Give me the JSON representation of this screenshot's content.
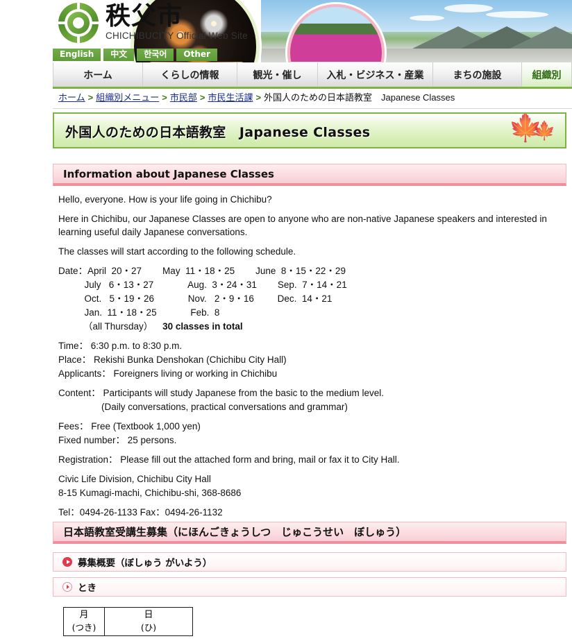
{
  "site": {
    "logo_jp": "秩父市",
    "logo_en": "CHICHIBUCITY Official Web Site",
    "logo_icon": "chichibu-city-emblem"
  },
  "lang_bar": {
    "items": [
      {
        "label": "English"
      },
      {
        "label": "中文"
      },
      {
        "label": "한국어"
      },
      {
        "label": "Other"
      }
    ]
  },
  "global_nav": {
    "items": [
      {
        "label": "ホーム",
        "active": false
      },
      {
        "label": "くらしの情報",
        "active": false
      },
      {
        "label": "観光・催し",
        "active": false
      },
      {
        "label": "入札・ビジネス・産業",
        "active": false
      },
      {
        "label": "まちの施設",
        "active": false
      },
      {
        "label": "組織別",
        "active": true
      }
    ]
  },
  "breadcrumb": {
    "links": [
      {
        "label": "ホーム"
      },
      {
        "label": "組織別メニュー"
      },
      {
        "label": "市民部"
      },
      {
        "label": "市民生活課"
      }
    ],
    "separator": ">",
    "current": "外国人のための日本語教室　Japanese Classes"
  },
  "page_title": "外国人のための日本語教室　Japanese Classes",
  "section_info": {
    "heading": "Information about Japanese Classes",
    "greeting": "Hello, everyone. How is your life going in Chichibu?",
    "intro": "Here in Chichibu, our Japanese Classes are open to anyone who are non-native Japanese speakers and interested in learning useful daily Japanese conversations.",
    "schedule_lead": "The classes will start according to the following schedule.",
    "schedule": {
      "label": "Date：",
      "rows": [
        "Date：April  20・27        May  11・18・25        June  8・15・22・29",
        "          July   6・13・27             Aug.  3・24・31        Sep.  7・14・21",
        "          Oct.   5・19・26             Nov.   2・9・16         Dec.  14・21",
        "          Jan.  11・18・25             Feb.  8"
      ],
      "footnote_left": "（all Thursday）",
      "footnote_bold": "30 classes in total"
    },
    "time": "Time：  6:30 p.m.   to   8:30 p.m.",
    "place": "Place：  Rekishi Bunka Denshokan   (Chichibu City Hall)",
    "applicants": "Applicants：  Foreigners living or working in Chichibu",
    "content_line1": "Content：  Participants will study Japanese from the basic to the medium level.",
    "content_line2": "(Daily conversations, practical conversations and grammar)",
    "fees": "Fees：  Free    (Textbook   1,000 yen)",
    "fixed_number": "Fixed number：  25 persons.",
    "registration": "Registration：  Please fill out the attached form and bring, mail or fax it to City Hall.",
    "division": "Civic Life Division, Chichibu City Hall",
    "address": "8-15 Kumagi-machi, Chichibu-shi, 368-8686",
    "contact": "Tel：0494-26-1133  Fax：0494-26-1132"
  },
  "section_jp": {
    "heading": "日本語教室受講生募集（にほんごきょうしつ　じゅこうせい　ぼしゅう）",
    "rows": [
      {
        "label": "募集概要（ぼしゅう がいよう）",
        "bullet": "solid-arrow-icon"
      },
      {
        "label": "とき",
        "bullet": "open-arrow-icon"
      }
    ],
    "table": {
      "headers": [
        "月",
        "日"
      ],
      "subheaders": [
        "(つき)",
        "(ひ)"
      ]
    }
  },
  "colors": {
    "brand_green": "#7cb342",
    "nav_active_text": "#2e6b12",
    "section_pink_border": "#f08e9e",
    "link_blue": "#1a2e8c",
    "bullet_red": "#e03a4e"
  }
}
